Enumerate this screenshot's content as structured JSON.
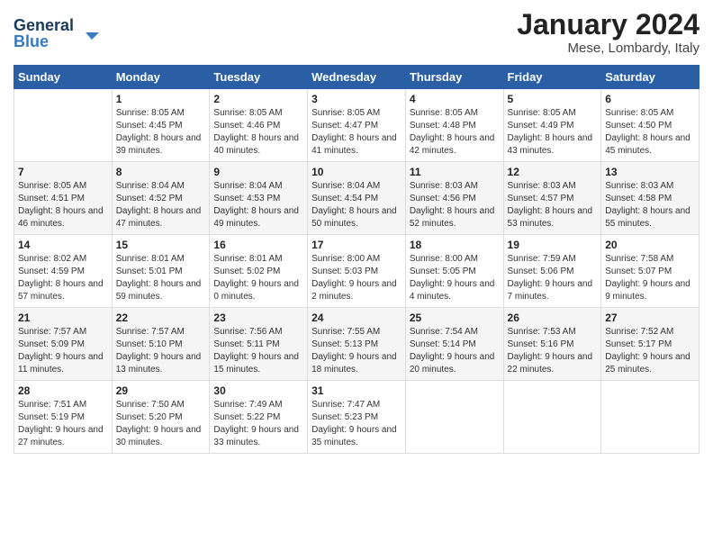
{
  "logo": {
    "line1": "General",
    "line2": "Blue"
  },
  "title": "January 2024",
  "location": "Mese, Lombardy, Italy",
  "days_of_week": [
    "Sunday",
    "Monday",
    "Tuesday",
    "Wednesday",
    "Thursday",
    "Friday",
    "Saturday"
  ],
  "weeks": [
    [
      {
        "day": "",
        "sunrise": "",
        "sunset": "",
        "daylight": ""
      },
      {
        "day": "1",
        "sunrise": "Sunrise: 8:05 AM",
        "sunset": "Sunset: 4:45 PM",
        "daylight": "Daylight: 8 hours and 39 minutes."
      },
      {
        "day": "2",
        "sunrise": "Sunrise: 8:05 AM",
        "sunset": "Sunset: 4:46 PM",
        "daylight": "Daylight: 8 hours and 40 minutes."
      },
      {
        "day": "3",
        "sunrise": "Sunrise: 8:05 AM",
        "sunset": "Sunset: 4:47 PM",
        "daylight": "Daylight: 8 hours and 41 minutes."
      },
      {
        "day": "4",
        "sunrise": "Sunrise: 8:05 AM",
        "sunset": "Sunset: 4:48 PM",
        "daylight": "Daylight: 8 hours and 42 minutes."
      },
      {
        "day": "5",
        "sunrise": "Sunrise: 8:05 AM",
        "sunset": "Sunset: 4:49 PM",
        "daylight": "Daylight: 8 hours and 43 minutes."
      },
      {
        "day": "6",
        "sunrise": "Sunrise: 8:05 AM",
        "sunset": "Sunset: 4:50 PM",
        "daylight": "Daylight: 8 hours and 45 minutes."
      }
    ],
    [
      {
        "day": "7",
        "sunrise": "Sunrise: 8:05 AM",
        "sunset": "Sunset: 4:51 PM",
        "daylight": "Daylight: 8 hours and 46 minutes."
      },
      {
        "day": "8",
        "sunrise": "Sunrise: 8:04 AM",
        "sunset": "Sunset: 4:52 PM",
        "daylight": "Daylight: 8 hours and 47 minutes."
      },
      {
        "day": "9",
        "sunrise": "Sunrise: 8:04 AM",
        "sunset": "Sunset: 4:53 PM",
        "daylight": "Daylight: 8 hours and 49 minutes."
      },
      {
        "day": "10",
        "sunrise": "Sunrise: 8:04 AM",
        "sunset": "Sunset: 4:54 PM",
        "daylight": "Daylight: 8 hours and 50 minutes."
      },
      {
        "day": "11",
        "sunrise": "Sunrise: 8:03 AM",
        "sunset": "Sunset: 4:56 PM",
        "daylight": "Daylight: 8 hours and 52 minutes."
      },
      {
        "day": "12",
        "sunrise": "Sunrise: 8:03 AM",
        "sunset": "Sunset: 4:57 PM",
        "daylight": "Daylight: 8 hours and 53 minutes."
      },
      {
        "day": "13",
        "sunrise": "Sunrise: 8:03 AM",
        "sunset": "Sunset: 4:58 PM",
        "daylight": "Daylight: 8 hours and 55 minutes."
      }
    ],
    [
      {
        "day": "14",
        "sunrise": "Sunrise: 8:02 AM",
        "sunset": "Sunset: 4:59 PM",
        "daylight": "Daylight: 8 hours and 57 minutes."
      },
      {
        "day": "15",
        "sunrise": "Sunrise: 8:01 AM",
        "sunset": "Sunset: 5:01 PM",
        "daylight": "Daylight: 8 hours and 59 minutes."
      },
      {
        "day": "16",
        "sunrise": "Sunrise: 8:01 AM",
        "sunset": "Sunset: 5:02 PM",
        "daylight": "Daylight: 9 hours and 0 minutes."
      },
      {
        "day": "17",
        "sunrise": "Sunrise: 8:00 AM",
        "sunset": "Sunset: 5:03 PM",
        "daylight": "Daylight: 9 hours and 2 minutes."
      },
      {
        "day": "18",
        "sunrise": "Sunrise: 8:00 AM",
        "sunset": "Sunset: 5:05 PM",
        "daylight": "Daylight: 9 hours and 4 minutes."
      },
      {
        "day": "19",
        "sunrise": "Sunrise: 7:59 AM",
        "sunset": "Sunset: 5:06 PM",
        "daylight": "Daylight: 9 hours and 7 minutes."
      },
      {
        "day": "20",
        "sunrise": "Sunrise: 7:58 AM",
        "sunset": "Sunset: 5:07 PM",
        "daylight": "Daylight: 9 hours and 9 minutes."
      }
    ],
    [
      {
        "day": "21",
        "sunrise": "Sunrise: 7:57 AM",
        "sunset": "Sunset: 5:09 PM",
        "daylight": "Daylight: 9 hours and 11 minutes."
      },
      {
        "day": "22",
        "sunrise": "Sunrise: 7:57 AM",
        "sunset": "Sunset: 5:10 PM",
        "daylight": "Daylight: 9 hours and 13 minutes."
      },
      {
        "day": "23",
        "sunrise": "Sunrise: 7:56 AM",
        "sunset": "Sunset: 5:11 PM",
        "daylight": "Daylight: 9 hours and 15 minutes."
      },
      {
        "day": "24",
        "sunrise": "Sunrise: 7:55 AM",
        "sunset": "Sunset: 5:13 PM",
        "daylight": "Daylight: 9 hours and 18 minutes."
      },
      {
        "day": "25",
        "sunrise": "Sunrise: 7:54 AM",
        "sunset": "Sunset: 5:14 PM",
        "daylight": "Daylight: 9 hours and 20 minutes."
      },
      {
        "day": "26",
        "sunrise": "Sunrise: 7:53 AM",
        "sunset": "Sunset: 5:16 PM",
        "daylight": "Daylight: 9 hours and 22 minutes."
      },
      {
        "day": "27",
        "sunrise": "Sunrise: 7:52 AM",
        "sunset": "Sunset: 5:17 PM",
        "daylight": "Daylight: 9 hours and 25 minutes."
      }
    ],
    [
      {
        "day": "28",
        "sunrise": "Sunrise: 7:51 AM",
        "sunset": "Sunset: 5:19 PM",
        "daylight": "Daylight: 9 hours and 27 minutes."
      },
      {
        "day": "29",
        "sunrise": "Sunrise: 7:50 AM",
        "sunset": "Sunset: 5:20 PM",
        "daylight": "Daylight: 9 hours and 30 minutes."
      },
      {
        "day": "30",
        "sunrise": "Sunrise: 7:49 AM",
        "sunset": "Sunset: 5:22 PM",
        "daylight": "Daylight: 9 hours and 33 minutes."
      },
      {
        "day": "31",
        "sunrise": "Sunrise: 7:47 AM",
        "sunset": "Sunset: 5:23 PM",
        "daylight": "Daylight: 9 hours and 35 minutes."
      },
      {
        "day": "",
        "sunrise": "",
        "sunset": "",
        "daylight": ""
      },
      {
        "day": "",
        "sunrise": "",
        "sunset": "",
        "daylight": ""
      },
      {
        "day": "",
        "sunrise": "",
        "sunset": "",
        "daylight": ""
      }
    ]
  ]
}
